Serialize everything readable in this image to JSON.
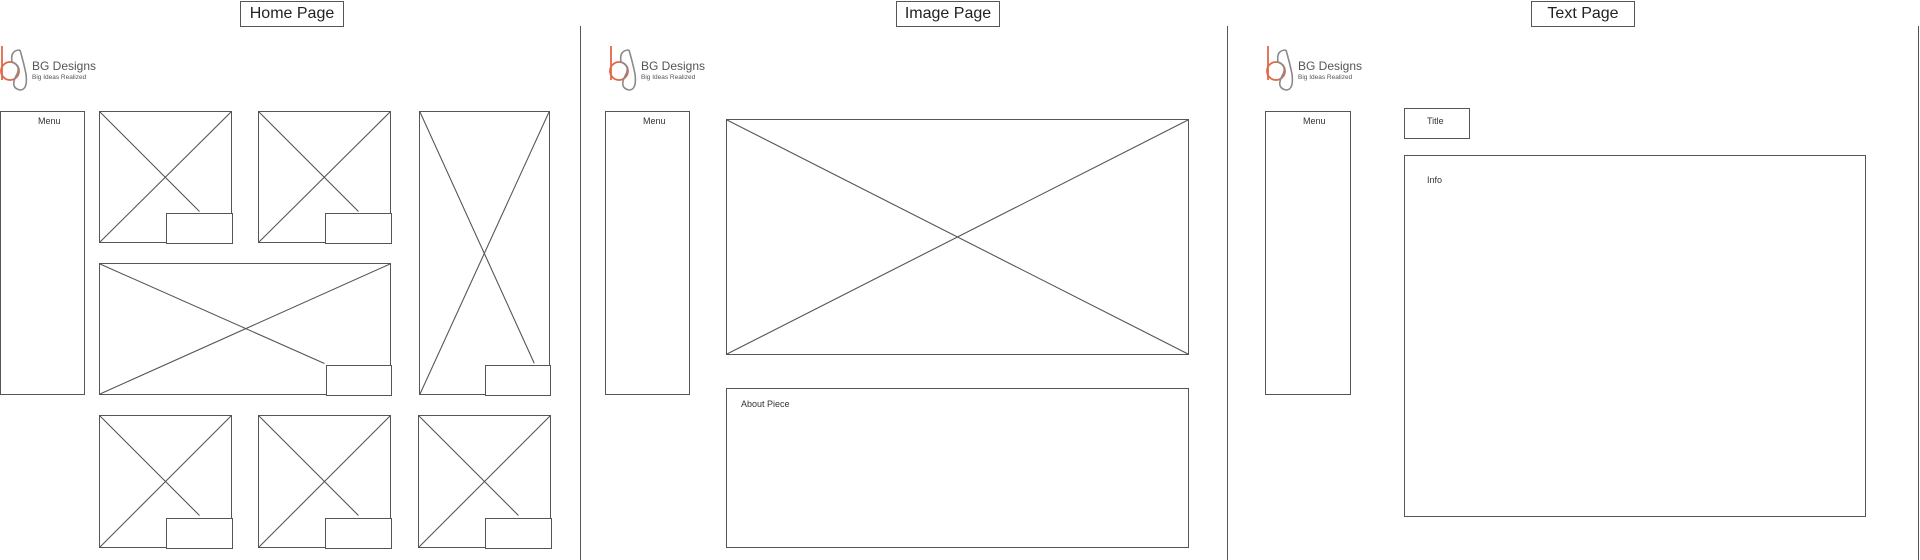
{
  "pages": {
    "home": {
      "label": "Home Page",
      "menu_label": "Menu"
    },
    "image": {
      "label": "Image Page",
      "menu_label": "Menu",
      "about_label": "About Piece"
    },
    "text": {
      "label": "Text Page",
      "menu_label": "Menu",
      "title_label": "Title",
      "info_label": "Info"
    }
  },
  "logo": {
    "name": "BG Designs",
    "tagline": "Big Ideas Realized",
    "accent_color": "#e0674a",
    "mark_color": "#8a8a8a"
  },
  "colors": {
    "wireframe_stroke": "#555555",
    "background": "#ffffff"
  }
}
